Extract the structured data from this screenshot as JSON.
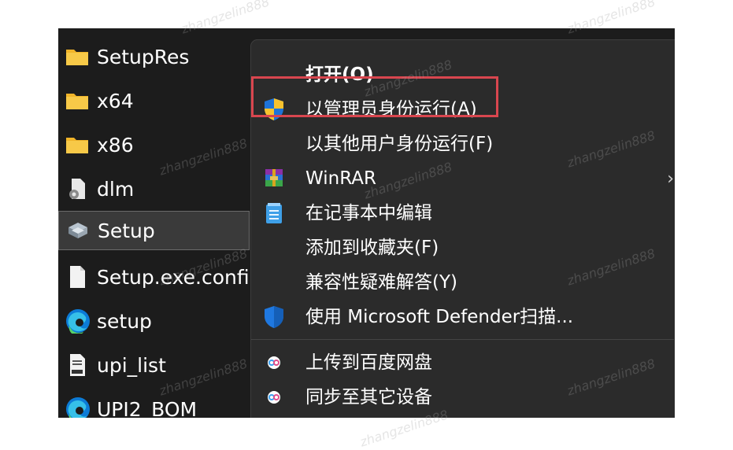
{
  "watermark": "zhangzelin888",
  "files": [
    {
      "name": "SetupRes",
      "icon": "folder-icon"
    },
    {
      "name": "x64",
      "icon": "folder-icon"
    },
    {
      "name": "x86",
      "icon": "folder-icon"
    },
    {
      "name": "dlm",
      "icon": "settings-file-icon"
    },
    {
      "name": "Setup",
      "icon": "setup-icon",
      "selected": true
    },
    {
      "name": "Setup.exe.config",
      "icon": "blank-file-icon"
    },
    {
      "name": "setup",
      "icon": "edge-icon"
    },
    {
      "name": "upi_list",
      "icon": "json-file-icon"
    },
    {
      "name": "UPI2_BOM",
      "icon": "edge-icon"
    }
  ],
  "context_menu": {
    "items": [
      {
        "label": "打开(O)",
        "icon": null,
        "bold": true
      },
      {
        "label": "以管理员身份运行(A)",
        "icon": "uac-shield-icon",
        "highlighted": true
      },
      {
        "label": "以其他用户身份运行(F)",
        "icon": null
      },
      {
        "label": "WinRAR",
        "icon": "winrar-icon",
        "submenu": true
      },
      {
        "label": "在记事本中编辑",
        "icon": "notepad-icon"
      },
      {
        "label": "添加到收藏夹(F)",
        "icon": null
      },
      {
        "label": "兼容性疑难解答(Y)",
        "icon": null
      },
      {
        "label": "使用 Microsoft Defender扫描...",
        "icon": "defender-icon"
      },
      {
        "label": "上传到百度网盘",
        "icon": "baidu-netdisk-icon"
      },
      {
        "label": "同步至其它设备",
        "icon": "baidu-netdisk-icon"
      }
    ],
    "submenu_glyph": "›"
  },
  "colors": {
    "background": "#1c1c1c",
    "menu_bg": "#2b2b2b",
    "highlight_border": "#d9464f",
    "folder": "#f7c948",
    "text": "#ffffff"
  }
}
